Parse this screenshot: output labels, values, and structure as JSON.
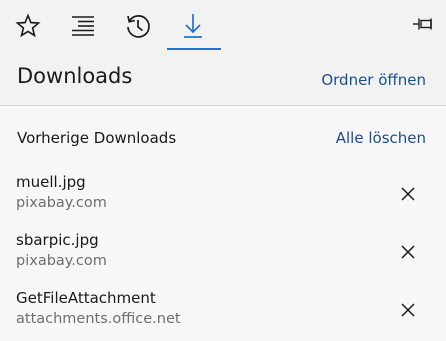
{
  "toolbar": {
    "tabs": [
      {
        "icon": "star-icon",
        "label": "Favoriten"
      },
      {
        "icon": "reading-list-icon",
        "label": "Leseliste"
      },
      {
        "icon": "history-icon",
        "label": "Verlauf"
      },
      {
        "icon": "download-icon",
        "label": "Downloads",
        "active": true
      }
    ],
    "pin_icon": "pin-icon"
  },
  "header": {
    "title": "Downloads",
    "open_folder_label": "Ordner öffnen"
  },
  "section": {
    "label": "Vorherige Downloads",
    "clear_all_label": "Alle löschen"
  },
  "downloads": [
    {
      "name": "muell.jpg",
      "source": "pixabay.com"
    },
    {
      "name": "sbarpic.jpg",
      "source": "pixabay.com"
    },
    {
      "name": "GetFileAttachment",
      "source": "attachments.office.net"
    }
  ],
  "colors": {
    "accent": "#1e73d2",
    "link": "#1b4f8a",
    "background": "#f2f2f2",
    "panel": "#f7f7f7",
    "secondary_text": "#6e6e6e"
  }
}
